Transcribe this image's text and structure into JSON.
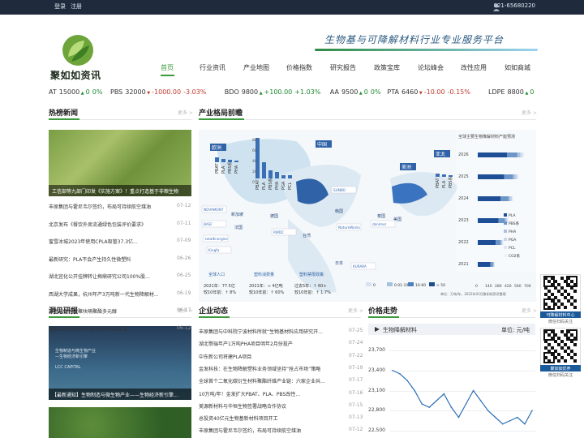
{
  "topbar": {
    "login": "登录",
    "register": "注册",
    "phone": "021-65680220"
  },
  "logo": {
    "name": "聚如如资讯"
  },
  "slogan": "生物基与可降解材料行业专业服务平台",
  "nav": [
    "首页",
    "行业资讯",
    "产业地图",
    "价格指数",
    "研究报告",
    "政策宝库",
    "论坛峰会",
    "改性应用",
    "如如商城"
  ],
  "ticker": [
    {
      "name": "AT",
      "price": "15000",
      "chg": "0",
      "pct": "0%",
      "dir": "up"
    },
    {
      "name": "PBS",
      "price": "32000",
      "chg": "-1000.00",
      "pct": "-3.03%",
      "dir": "dn"
    },
    {
      "name": "BDO",
      "price": "9800",
      "chg": "+100.00",
      "pct": "+1.03%",
      "dir": "up"
    },
    {
      "name": "AA",
      "price": "9500",
      "chg": "0",
      "pct": "0%",
      "dir": "up"
    },
    {
      "name": "PTA",
      "price": "6460",
      "chg": "-10.00",
      "pct": "-0.15%",
      "dir": "dn"
    },
    {
      "name": "LDPE",
      "price": "8800",
      "chg": "0",
      "pct": "0%",
      "dir": "up"
    },
    {
      "name": "PP",
      "price": "7650",
      "chg": "0",
      "pct": "0%",
      "dir": "up"
    }
  ],
  "sections": {
    "hot_news": "热榜新闻",
    "industry": "产业格局前瞻",
    "reports": "洞见研报",
    "corp": "企业动态",
    "price": "价格走势",
    "more": "更多 >"
  },
  "hot_news": {
    "photo_caption": "工信部等九部门印发《实施方案》！重点打造基于非粮生物",
    "items": [
      {
        "t": "丰原集团与霍尼韦尔签约，布局可持续航空煤油",
        "d": "07-12"
      },
      {
        "t": "北京发布《餐饮外卖流通绿色包装评价要求》",
        "d": "07-11"
      },
      {
        "t": "蜜雪冰城2023年使用CPLA吸管37.3亿...",
        "d": "07-09"
      },
      {
        "t": "最新研究：PLA不会产生持久性微塑料",
        "d": "06-26"
      },
      {
        "t": "湖北宜化公开挂牌转让梅鼎研究公司100%股...",
        "d": "06-25"
      },
      {
        "t": "西湖大学成果，杭州年产3万吨新一代生物降解材...",
        "d": "06-19"
      },
      {
        "t": "高性能生物基聚呋喃聚酯多元醇",
        "d": "06-17"
      },
      {
        "t": "德国DITF研究所开发出纯PBS合成革",
        "d": "06-12"
      }
    ]
  },
  "map": {
    "regions": [
      "欧洲",
      "中国",
      "美洲",
      "亚太"
    ],
    "bar_labels": [
      "PBAT",
      "PLA",
      "PBS系",
      "PHA",
      "PGA",
      "PCL"
    ],
    "bar_axis": [
      "80",
      "60",
      "40",
      "20",
      "0"
    ],
    "china_labels": [
      "新加坡",
      "台湾",
      "日本",
      "韩国",
      "泰国",
      "法国",
      "德国",
      "美国",
      "意大利"
    ],
    "brands": [
      "BASF",
      "totalEnergies",
      "NOVAMONT",
      "NatureWorks",
      "danimer",
      "KURARA",
      "Kingfa",
      "SUNBO",
      "RWDC"
    ],
    "stats": [
      {
        "label": "全球人口",
        "sub": "2021年：77.5亿",
        "val": "较10年前：↑ 8%"
      },
      {
        "label": "塑料消费量",
        "sub": "2021年：≈ 4亿吨",
        "val": "较10年前：↑ 60%"
      },
      {
        "label": "塑料禁限政策",
        "sub": "过去5年：↑ 60+",
        "val": "较10年前：↑ 1.7%"
      }
    ],
    "legend": [
      "0",
      "0.01-10",
      "10-60",
      "> 50"
    ],
    "legend_note": "单位：万吨/年，2022年01月聚如如资讯整理",
    "capacity_title": "全球主要生物降解材料产能预测",
    "capacity_years": [
      "2026",
      "2025",
      "2024",
      "2023",
      "2022",
      "2021"
    ],
    "capacity_axis": [
      "0",
      "140",
      "280",
      "420",
      "560",
      "700"
    ],
    "capacity_legend": [
      "PLA",
      "PBS系",
      "PHA",
      "PGA",
      "PCL",
      "CO2系"
    ],
    "capacity": [
      {
        "y": "2026",
        "v": [
          420,
          150,
          40,
          30,
          10,
          20
        ]
      },
      {
        "y": "2025",
        "v": [
          380,
          130,
          35,
          25,
          8,
          15
        ]
      },
      {
        "y": "2024",
        "v": [
          330,
          115,
          28,
          20,
          7,
          10
        ]
      },
      {
        "y": "2023",
        "v": [
          300,
          90,
          22,
          15,
          6,
          8
        ]
      },
      {
        "y": "2022",
        "v": [
          260,
          70,
          18,
          10,
          5,
          6
        ]
      },
      {
        "y": "2021",
        "v": [
          180,
          40,
          12,
          6,
          4,
          5
        ]
      }
    ]
  },
  "reports": {
    "caption": "【最新通知】生物制造与微生物产业——生物经济新引擎...",
    "label1": "生物制造与微生物产业",
    "label2": "—生物经济新引擎",
    "label3": "LCC CAPITAL"
  },
  "corp": [
    {
      "t": "丰原集团与中科院宁波材料所就“生物基材料应用研究开...",
      "d": "07-25"
    },
    {
      "t": "湖北鄂瑞年产1万吨PHA项目明年2月份投产",
      "d": "07-24"
    },
    {
      "t": "中东新公司将建PLA项目",
      "d": "07-22"
    },
    {
      "t": "金发科技：在生物降解塑料业务领域坚持“抢占市场”策略",
      "d": "07-19"
    },
    {
      "t": "全球首个二氧化碳衍生材料聚酯纤维产业链：六家企业共...",
      "d": "07-17"
    },
    {
      "t": "10万吨/年！金发扩大PBAT、PLA、PBS改性...",
      "d": "07-16"
    },
    {
      "t": "美源新材料与华恒生物签署战略合作协议",
      "d": "07-15"
    },
    {
      "t": "总投资40亿元生物基新材料项目开工",
      "d": "07-13"
    },
    {
      "t": "丰原集团与霍尼韦尔签约，布局可持续航空煤油",
      "d": "07-12"
    }
  ],
  "price_chart": {
    "series_label": "生物降解材料",
    "unit": "单位: 元/吨",
    "yticks": [
      "23,700",
      "23,400",
      "23,100",
      "22,800",
      "22,500"
    ]
  },
  "chart_data": {
    "type": "line",
    "x": [
      1,
      2,
      3,
      4,
      5,
      6,
      7,
      8,
      9,
      10,
      11,
      12,
      13,
      14,
      15,
      16,
      17,
      18,
      19,
      20
    ],
    "values": [
      23400,
      23350,
      23250,
      23100,
      22900,
      22850,
      22950,
      23050,
      22850,
      22700,
      22900,
      23100,
      22950,
      22800,
      22700,
      22600,
      22650,
      22700,
      22600,
      22800
    ],
    "ylabel": "单位: 元/吨",
    "ylim": [
      22500,
      23700
    ],
    "grid": true
  },
  "qr": {
    "a": "可降解材料中心",
    "a2": "微信扫码关注",
    "b": "聚如如优养",
    "b2": "微信扫码关注"
  }
}
